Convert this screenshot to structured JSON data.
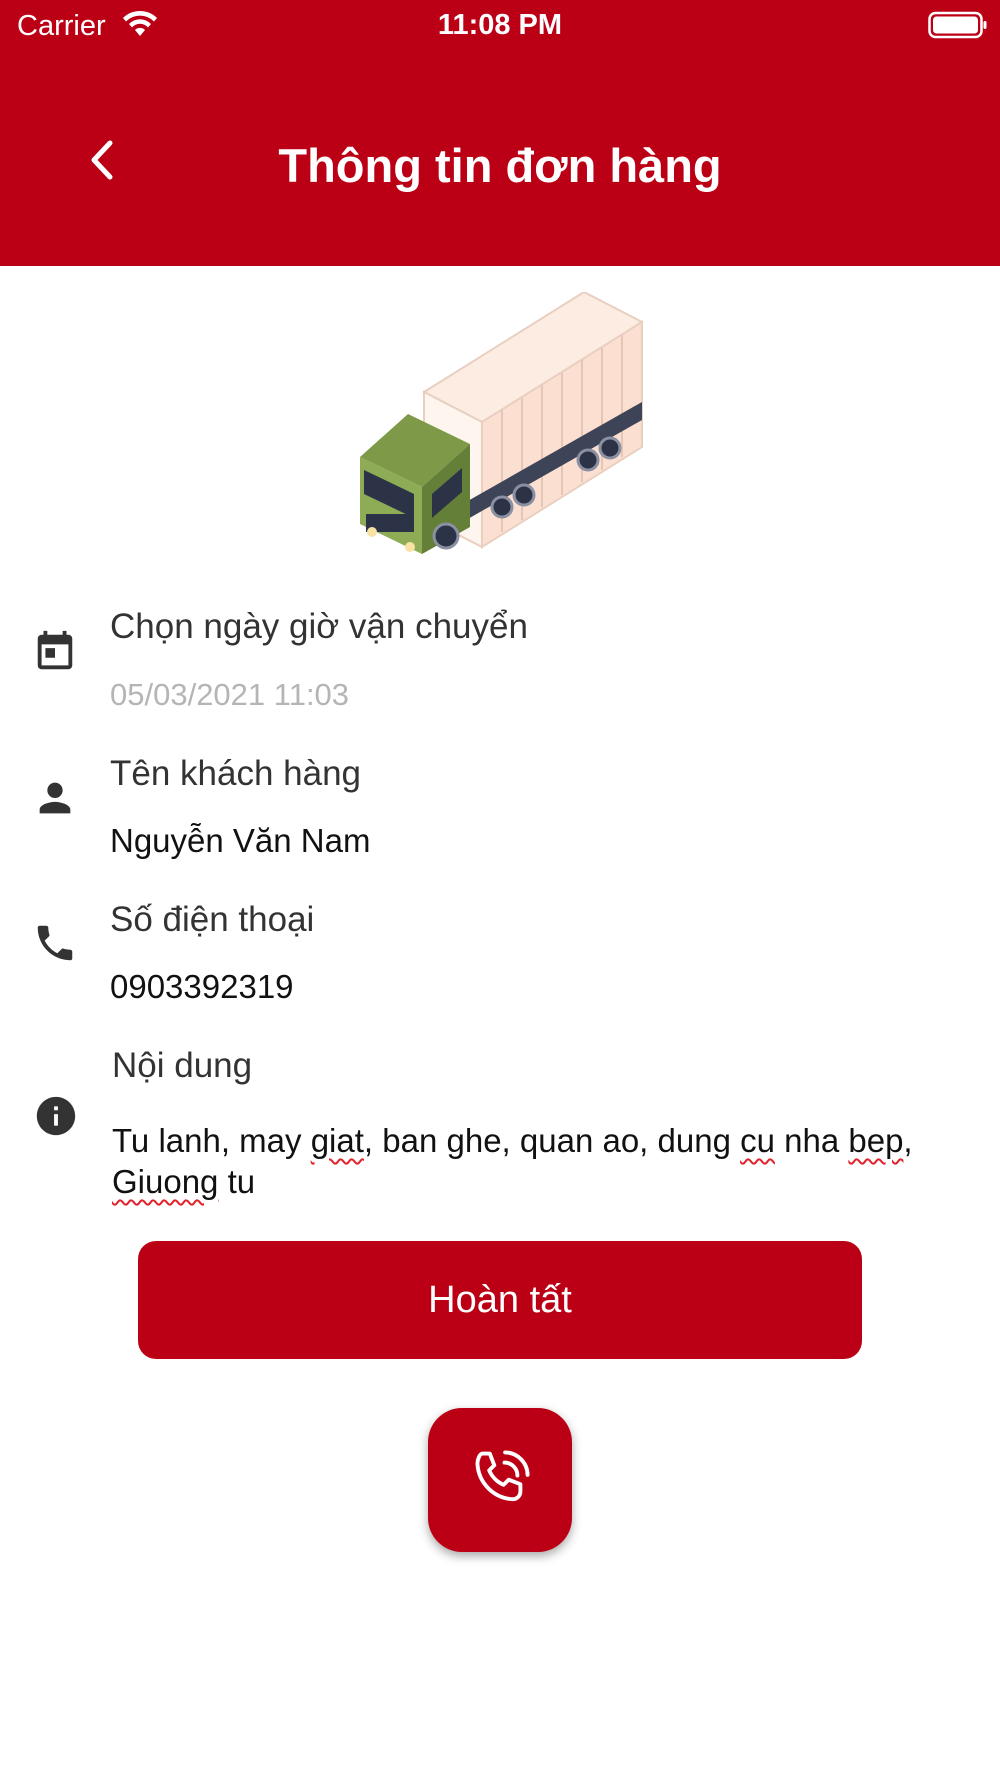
{
  "status_bar": {
    "carrier": "Carrier",
    "time": "11:08 PM",
    "icons": [
      "wifi-icon",
      "battery-icon"
    ]
  },
  "header": {
    "title": "Thông tin đơn hàng",
    "back_icon": "chevron-left-icon",
    "background_color": "#bb0016"
  },
  "illustration": "truck-illustration",
  "fields": {
    "date": {
      "icon": "calendar-icon",
      "label": "Chọn ngày giờ vận chuyển",
      "value": "05/03/2021 11:03"
    },
    "customer": {
      "icon": "person-icon",
      "label": "Tên khách hàng",
      "value": "Nguyễn Văn Nam"
    },
    "phone": {
      "icon": "phone-icon",
      "label": "Số điện thoại",
      "value": "0903392319"
    },
    "content": {
      "icon": "info-icon",
      "label": "Nội dung",
      "words": {
        "w1": "Tu lanh, may ",
        "w2": "giat",
        "w3": ", ban ghe, quan ao, dung ",
        "w4": "cu",
        "w5": " nha ",
        "w6": "bep",
        "w7": ", ",
        "w8": "Giuong",
        "w9": " tu"
      }
    }
  },
  "actions": {
    "done_label": "Hoàn tất",
    "call_icon": "phone-call-icon"
  },
  "colors": {
    "primary": "#bb0016",
    "placeholder_text": "#b5b5b5",
    "icon": "#333333",
    "spellcheck": "#e0222c"
  }
}
